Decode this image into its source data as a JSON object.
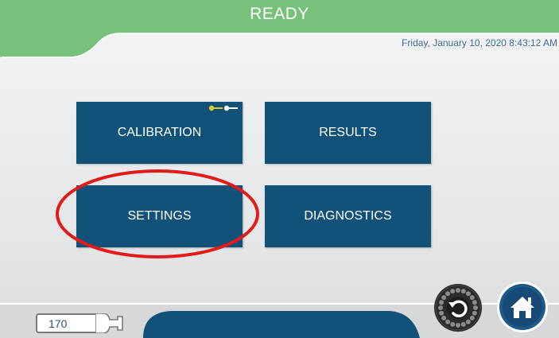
{
  "header": {
    "status": "READY",
    "datetime": "Friday, January 10, 2020 8:43:12 AM",
    "color": "#77c17a"
  },
  "menu": {
    "tiles": [
      {
        "label": "CALIBRATION",
        "locked": true
      },
      {
        "label": "RESULTS"
      },
      {
        "label": "SETTINGS",
        "highlighted": true
      },
      {
        "label": "DIAGNOSTICS"
      }
    ],
    "tile_color": "#125178"
  },
  "footer": {
    "counter": "170",
    "reset_icon": "reset-carousel-icon",
    "home_icon": "home-icon"
  }
}
